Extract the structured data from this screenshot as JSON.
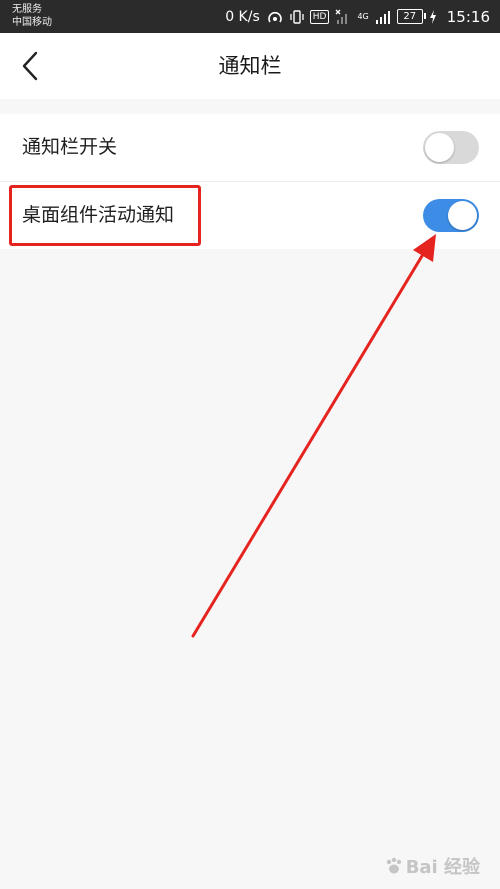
{
  "status_bar": {
    "carrier_line1": "无服务",
    "carrier_line2": "中国移动",
    "network_speed": "0 K/s",
    "hd_label": "HD",
    "network_type": "4G",
    "battery": "27",
    "time": "15:16"
  },
  "header": {
    "title": "通知栏",
    "back_icon": "chevron-left-icon"
  },
  "settings": [
    {
      "label": "通知栏开关",
      "enabled": false
    },
    {
      "label": "桌面组件活动通知",
      "enabled": true
    }
  ],
  "colors": {
    "toggle_on": "#3d8de6",
    "toggle_off": "#d9d9d9",
    "annotation": "#e5231f"
  },
  "watermark": {
    "text": "Bai 经验"
  }
}
